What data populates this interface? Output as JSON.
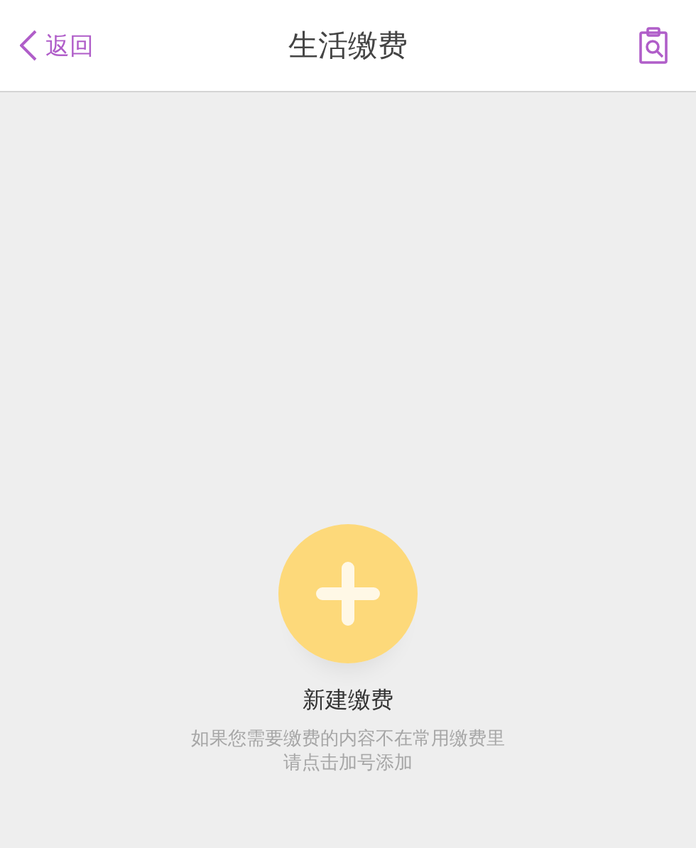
{
  "header": {
    "back": "返回",
    "title": "生活缴费"
  },
  "empty_state": {
    "action_label": "新建缴费",
    "hint_lines": [
      "如果您需要缴费的内容不在常用缴费里",
      "请点击加号添加"
    ]
  }
}
